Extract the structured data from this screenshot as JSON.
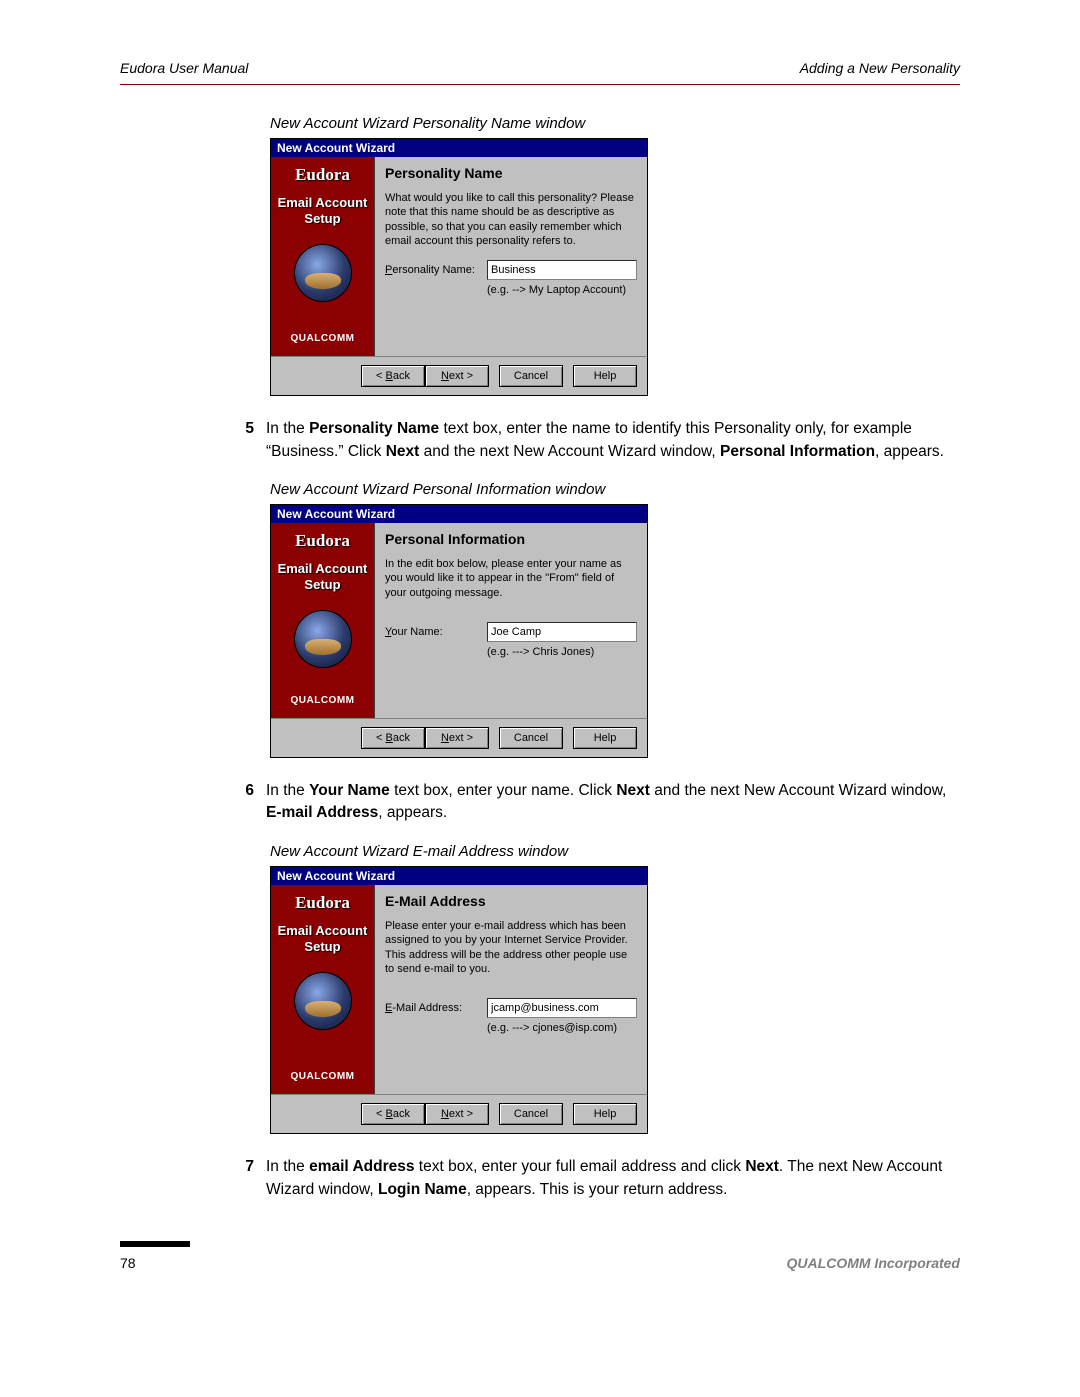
{
  "header": {
    "left": "Eudora User Manual",
    "right": "Adding a New Personality"
  },
  "page_number": "78",
  "corp": "QUALCOMM Incorporated",
  "captions": {
    "c1": "New Account Wizard Personality Name window",
    "c2": "New Account Wizard Personal Information window",
    "c3": "New Account Wizard E-mail Address window"
  },
  "wizard_common": {
    "title": "New Account Wizard",
    "brand": "Eudora",
    "subtitle_line1": "Email Account",
    "subtitle_line2": "Setup",
    "qualcomm": "QUALCOMM",
    "buttons": {
      "back": "< Back",
      "next": "Next >",
      "cancel": "Cancel",
      "help": "Help"
    }
  },
  "wizard1": {
    "heading": "Personality Name",
    "desc": "What would you like to call this personality? Please note that this name should be as descriptive as possible, so that you can easily remember which email account this personality refers to.",
    "label": "Personality Name:",
    "value": "Business",
    "example": "(e.g. --> My Laptop Account)"
  },
  "wizard2": {
    "heading": "Personal Information",
    "desc": "In the edit box below, please enter your name as you would like it to appear in the \"From\" field of your outgoing message.",
    "label": "Your Name:",
    "value": "Joe Camp",
    "example": "(e.g. ---> Chris Jones)"
  },
  "wizard3": {
    "heading": "E-Mail Address",
    "desc": "Please enter your e-mail address which has been assigned to you by your Internet Service Provider. This address will be the address other people use to send e-mail to you.",
    "label": "E-Mail Address:",
    "value": "jcamp@business.com",
    "example": "(e.g. ---> cjones@isp.com)"
  },
  "steps": {
    "s5": {
      "num": "5",
      "t1": "In the ",
      "b1": "Personality Name",
      "t2": " text box, enter the name to identify this Personality only, for example “Business.” Click ",
      "b2": "Next",
      "t3": " and the next New Account Wizard window, ",
      "b3": "Personal Information",
      "t4": ", appears."
    },
    "s6": {
      "num": "6",
      "t1": "In the ",
      "b1": "Your Name",
      "t2": " text box, enter your name. Click ",
      "b2": "Next",
      "t3": " and the next New Account Wizard window, ",
      "b3": "E-mail Address",
      "t4": ", appears."
    },
    "s7": {
      "num": "7",
      "t1": "In the ",
      "b1": "email Address",
      "t2": " text box, enter your full email address and click ",
      "b2": "Next",
      "t3": ". The next New Account Wizard window, ",
      "b3": "Login Name",
      "t4": ", appears. This is your return address."
    }
  }
}
